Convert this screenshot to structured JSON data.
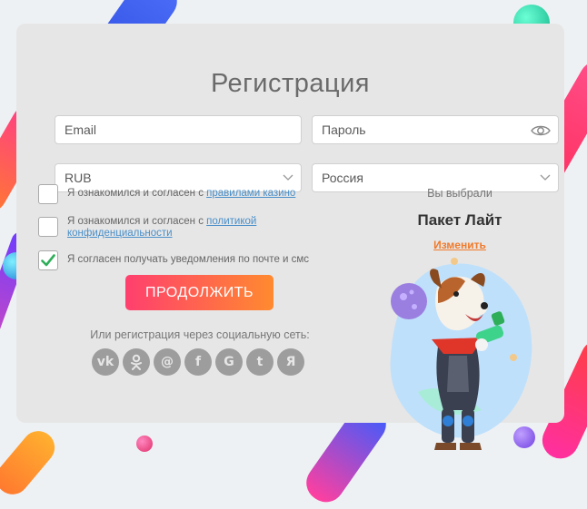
{
  "form": {
    "title": "Регистрация",
    "email_placeholder": "Email",
    "password_placeholder": "Пароль",
    "currency": "RUB",
    "country": "Россия",
    "checkbox_1": {
      "text": "Я ознакомился и согласен с ",
      "link": "правилами казино",
      "checked": false
    },
    "checkbox_2": {
      "text": "Я ознакомился и согласен с ",
      "link": "политикой конфиденциальности",
      "checked": false
    },
    "checkbox_3": {
      "text": "Я согласен получать уведомления по почте и смс",
      "checked": true
    },
    "submit_label": "ПРОДОЛЖИТЬ",
    "social_note": "Или регистрация через социальную сеть:",
    "social_networks": [
      "vk-icon",
      "odnoklassniki-icon",
      "mailru-icon",
      "facebook-icon",
      "google-icon",
      "twitter-icon",
      "yandex-icon"
    ]
  },
  "package": {
    "chosen_label": "Вы выбрали",
    "name": "Пакет Лайт",
    "change_label": "Изменить"
  },
  "colors": {
    "accent_gradient_start": "#ff3f6e",
    "accent_gradient_end": "#ff8a2f",
    "link": "#4a8fc8",
    "change_link": "#f07a2a",
    "check": "#2fae5a"
  }
}
